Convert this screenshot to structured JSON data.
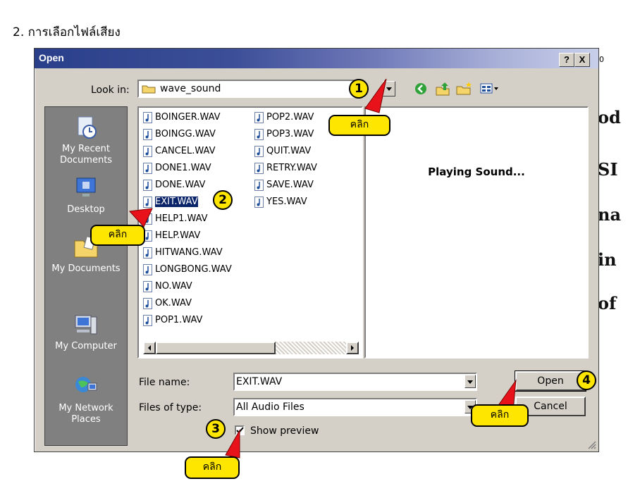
{
  "heading": "2. การเลือกไฟล์เสียง",
  "background_doc": {
    "fragments": [
      "od",
      "SI",
      "na",
      "in",
      "of"
    ],
    "ruler": "0"
  },
  "dialog": {
    "title": "Open",
    "help_button": "?",
    "close_button": "X",
    "look_in_label": "Look in:",
    "look_in_value": "wave_sound",
    "toolbar_icons": [
      "back-icon",
      "up-folder-icon",
      "new-folder-icon",
      "views-menu-icon"
    ]
  },
  "places_bar": [
    {
      "label": "My Recent Documents",
      "icon": "recent-documents-icon"
    },
    {
      "label": "Desktop",
      "icon": "desktop-icon"
    },
    {
      "label": "My Documents",
      "icon": "my-documents-icon"
    },
    {
      "label": "My Computer",
      "icon": "my-computer-icon"
    },
    {
      "label": "My Network Places",
      "icon": "network-places-icon"
    }
  ],
  "files_column1": [
    "BOINGER.WAV",
    "BOINGG.WAV",
    "CANCEL.WAV",
    "DONE1.WAV",
    "DONE.WAV",
    "EXIT.WAV",
    "HELP1.WAV",
    "HELP.WAV",
    "HITWANG.WAV",
    "LONGBONG.WAV",
    "NO.WAV",
    "OK.WAV",
    "POP1.WAV"
  ],
  "files_column2": [
    "POP2.WAV",
    "POP3.WAV",
    "QUIT.WAV",
    "RETRY.WAV",
    "SAVE.WAV",
    "YES.WAV"
  ],
  "selected_file": "EXIT.WAV",
  "preview_text": "Playing Sound...",
  "file_name_label": "File name:",
  "file_name_value": "EXIT.WAV",
  "files_of_type_label": "Files of type:",
  "files_of_type_value": "All Audio Files",
  "show_preview_label": "Show preview",
  "show_preview_checked": true,
  "open_button": "Open",
  "cancel_button": "Cancel",
  "callouts": {
    "click": "คลิก"
  },
  "step_numbers": [
    "1",
    "2",
    "3",
    "4"
  ],
  "colors": {
    "callout_yellow": "#ffe600",
    "arrow_red": "#e8121b",
    "titlebar_blue": "#2a3f8a",
    "selection": "#0a246a"
  }
}
